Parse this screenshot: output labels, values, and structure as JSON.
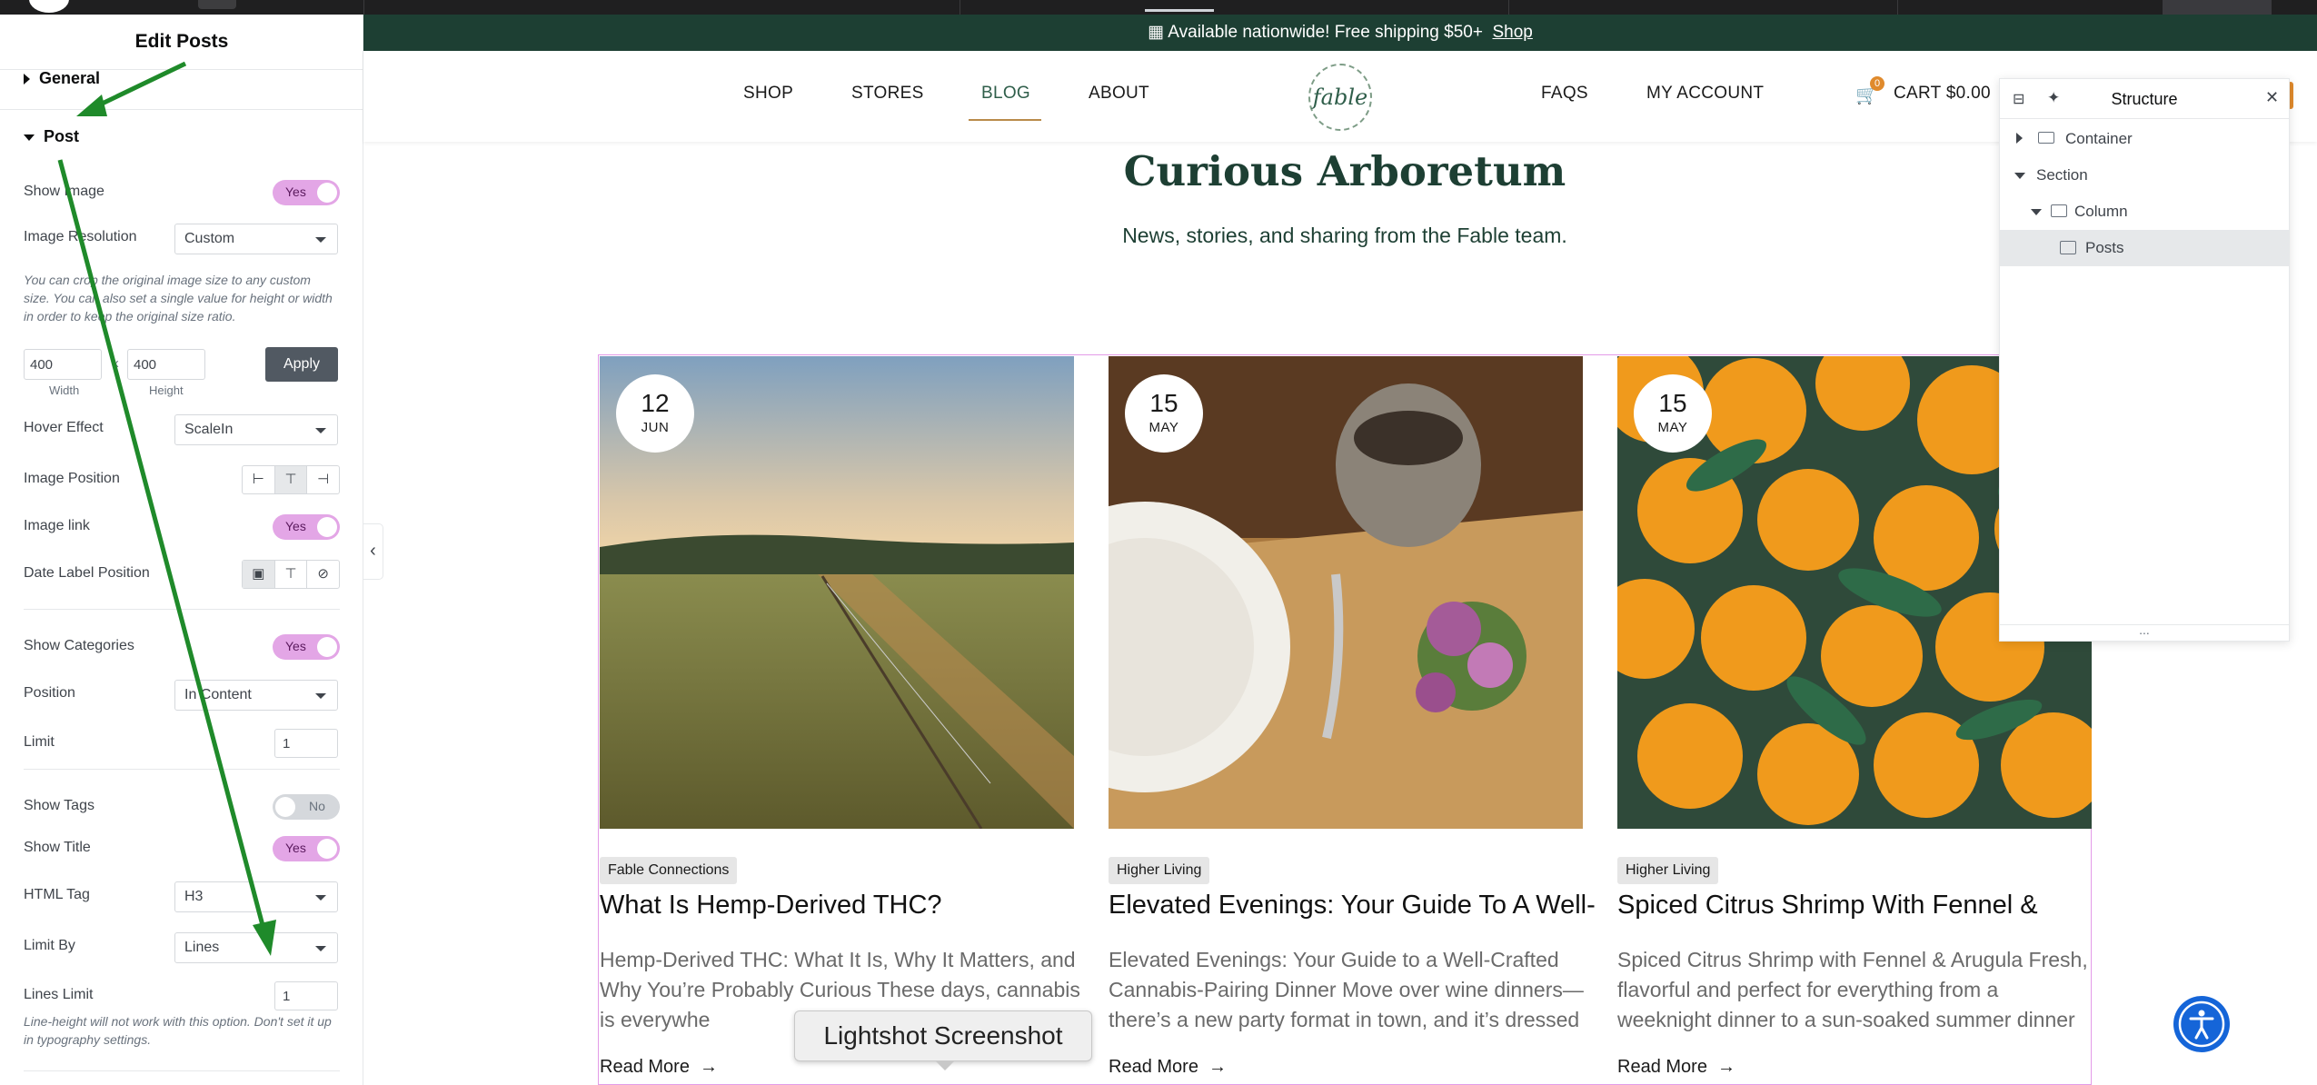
{
  "panel": {
    "title": "Edit Posts",
    "sections": {
      "general": "General",
      "post": "Post"
    },
    "show_image": {
      "label": "Show Image",
      "value": "Yes"
    },
    "image_resolution": {
      "label": "Image Resolution",
      "value": "Custom"
    },
    "resolution_help": "You can crop the original image size to any custom size. You can also set a single value for height or width in order to keep the original size ratio.",
    "width": {
      "value": "400",
      "label": "Width"
    },
    "height": {
      "value": "400",
      "label": "Height"
    },
    "times": "x",
    "apply_label": "Apply",
    "hover_effect": {
      "label": "Hover Effect",
      "value": "ScaleIn"
    },
    "image_position": {
      "label": "Image Position"
    },
    "image_link": {
      "label": "Image link",
      "value": "Yes"
    },
    "date_label_position": {
      "label": "Date Label Position"
    },
    "show_categories": {
      "label": "Show Categories",
      "value": "Yes"
    },
    "position": {
      "label": "Position",
      "value": "In Content"
    },
    "limit": {
      "label": "Limit",
      "value": "1"
    },
    "show_tags": {
      "label": "Show Tags",
      "value": "No"
    },
    "show_title": {
      "label": "Show Title",
      "value": "Yes"
    },
    "html_tag": {
      "label": "HTML Tag",
      "value": "H3"
    },
    "limit_by": {
      "label": "Limit By",
      "value": "Lines"
    },
    "lines_limit": {
      "label": "Lines Limit",
      "value": "1"
    },
    "lines_help": "Line-height will not work with this option. Don't set it up in typography settings.",
    "collapse_glyph": "‹"
  },
  "site": {
    "announcement": "Available nationwide! Free shipping $50+",
    "announcement_link": "Shop",
    "nav": [
      "SHOP",
      "STORES",
      "BLOG",
      "ABOUT"
    ],
    "nav_right": [
      "FAQS",
      "MY ACCOUNT"
    ],
    "logo_text": "fable",
    "cart_label": "CART $0.00",
    "cart_count": "0",
    "blog_title": "Curious Arboretum",
    "blog_subtitle": "News, stories, and sharing from the Fable team.",
    "read_more": "Read More",
    "posts": [
      {
        "day": "12",
        "month": "JUN",
        "category": "Fable Connections",
        "title": "What Is Hemp-Derived THC?",
        "excerpt": "Hemp-Derived THC: What It Is, Why It Matters, and Why You’re Probably Curious These days, cannabis is everywhe"
      },
      {
        "day": "15",
        "month": "MAY",
        "category": "Higher Living",
        "title": "Elevated Evenings: Your Guide To A Well-",
        "excerpt": "Elevated Evenings: Your Guide to a Well-Crafted Cannabis-Pairing Dinner Move over wine dinners—there’s a new party format in town, and it’s dressed"
      },
      {
        "day": "15",
        "month": "MAY",
        "category": "Higher Living",
        "title": "Spiced Citrus Shrimp With Fennel &",
        "excerpt": "Spiced Citrus Shrimp with Fennel & Arugula Fresh, flavorful and perfect for everything from a weeknight dinner to a sun-soaked summer dinner"
      }
    ]
  },
  "structure": {
    "title": "Structure",
    "items": [
      "Container",
      "Section",
      "Column",
      "Posts"
    ],
    "more": "..."
  },
  "overlay": {
    "lightshot": "Lightshot Screenshot"
  },
  "colors": {
    "accent": "#e3a6e6",
    "site_green": "#1d3f33",
    "cart_orange": "#e08a2c",
    "a11y_blue": "#1565d8",
    "arrow_green": "#1f8a2a"
  }
}
